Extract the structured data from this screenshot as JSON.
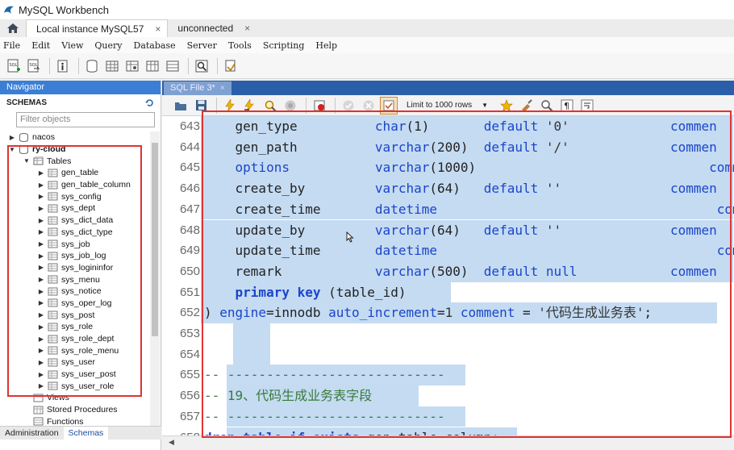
{
  "window": {
    "title": "MySQL Workbench"
  },
  "tabs": [
    {
      "label": "Local instance MySQL57",
      "close": "×",
      "active": true
    },
    {
      "label": "unconnected",
      "close": "×",
      "active": false
    }
  ],
  "menu": [
    "File",
    "Edit",
    "View",
    "Query",
    "Database",
    "Server",
    "Tools",
    "Scripting",
    "Help"
  ],
  "navigator": {
    "header": "Navigator",
    "schemas_label": "SCHEMAS",
    "filter_placeholder": "Filter objects",
    "tree": [
      {
        "label": "nacos",
        "indent": 0,
        "arrow": "▶",
        "icon": "database-icon",
        "bold": false
      },
      {
        "label": "ry-cloud",
        "indent": 0,
        "arrow": "▼",
        "icon": "database-icon",
        "bold": true
      },
      {
        "label": "Tables",
        "indent": 1,
        "arrow": "▼",
        "icon": "tables-folder-icon",
        "bold": false
      },
      {
        "label": "gen_table",
        "indent": 2,
        "arrow": "▶",
        "icon": "table-icon",
        "bold": false
      },
      {
        "label": "gen_table_column",
        "indent": 2,
        "arrow": "▶",
        "icon": "table-icon",
        "bold": false
      },
      {
        "label": "sys_config",
        "indent": 2,
        "arrow": "▶",
        "icon": "table-icon",
        "bold": false
      },
      {
        "label": "sys_dept",
        "indent": 2,
        "arrow": "▶",
        "icon": "table-icon",
        "bold": false
      },
      {
        "label": "sys_dict_data",
        "indent": 2,
        "arrow": "▶",
        "icon": "table-icon",
        "bold": false
      },
      {
        "label": "sys_dict_type",
        "indent": 2,
        "arrow": "▶",
        "icon": "table-icon",
        "bold": false
      },
      {
        "label": "sys_job",
        "indent": 2,
        "arrow": "▶",
        "icon": "table-icon",
        "bold": false
      },
      {
        "label": "sys_job_log",
        "indent": 2,
        "arrow": "▶",
        "icon": "table-icon",
        "bold": false
      },
      {
        "label": "sys_logininfor",
        "indent": 2,
        "arrow": "▶",
        "icon": "table-icon",
        "bold": false
      },
      {
        "label": "sys_menu",
        "indent": 2,
        "arrow": "▶",
        "icon": "table-icon",
        "bold": false
      },
      {
        "label": "sys_notice",
        "indent": 2,
        "arrow": "▶",
        "icon": "table-icon",
        "bold": false
      },
      {
        "label": "sys_oper_log",
        "indent": 2,
        "arrow": "▶",
        "icon": "table-icon",
        "bold": false
      },
      {
        "label": "sys_post",
        "indent": 2,
        "arrow": "▶",
        "icon": "table-icon",
        "bold": false
      },
      {
        "label": "sys_role",
        "indent": 2,
        "arrow": "▶",
        "icon": "table-icon",
        "bold": false
      },
      {
        "label": "sys_role_dept",
        "indent": 2,
        "arrow": "▶",
        "icon": "table-icon",
        "bold": false
      },
      {
        "label": "sys_role_menu",
        "indent": 2,
        "arrow": "▶",
        "icon": "table-icon",
        "bold": false
      },
      {
        "label": "sys_user",
        "indent": 2,
        "arrow": "▶",
        "icon": "table-icon",
        "bold": false
      },
      {
        "label": "sys_user_post",
        "indent": 2,
        "arrow": "▶",
        "icon": "table-icon",
        "bold": false
      },
      {
        "label": "sys_user_role",
        "indent": 2,
        "arrow": "▶",
        "icon": "table-icon",
        "bold": false
      },
      {
        "label": "Views",
        "indent": 1,
        "arrow": "",
        "icon": "views-folder-icon",
        "bold": false
      },
      {
        "label": "Stored Procedures",
        "indent": 1,
        "arrow": "",
        "icon": "procedures-folder-icon",
        "bold": false
      },
      {
        "label": "Functions",
        "indent": 1,
        "arrow": "",
        "icon": "functions-folder-icon",
        "bold": false
      }
    ],
    "bottom_tabs": [
      {
        "label": "Administration",
        "active": false
      },
      {
        "label": "Schemas",
        "active": true
      }
    ]
  },
  "editor": {
    "tab_label": "SQL File 3*",
    "tab_close": "×",
    "limit_label": "Limit to 1000 rows",
    "lines": [
      {
        "n": "643",
        "sel": [
          48,
          660
        ],
        "segs": [
          [
            "",
            "    "
          ],
          [
            "",
            "gen_type          "
          ],
          [
            "kt",
            "char"
          ],
          [
            "",
            "(1)       "
          ],
          [
            "kd",
            "default"
          ],
          [
            "",
            " "
          ],
          [
            "str",
            "'0'"
          ],
          [
            "",
            "             "
          ],
          [
            "kd",
            "commen"
          ]
        ]
      },
      {
        "n": "644",
        "sel": [
          48,
          660
        ],
        "segs": [
          [
            "",
            "    "
          ],
          [
            "",
            "gen_path          "
          ],
          [
            "kt",
            "varchar"
          ],
          [
            "",
            "(200)  "
          ],
          [
            "kd",
            "default"
          ],
          [
            "",
            " "
          ],
          [
            "str",
            "'/'"
          ],
          [
            "",
            "             "
          ],
          [
            "kd",
            "commen"
          ]
        ]
      },
      {
        "n": "645",
        "sel": [
          48,
          660
        ],
        "segs": [
          [
            "",
            "    "
          ],
          [
            "kd",
            "options"
          ],
          [
            "",
            "           "
          ],
          [
            "kt",
            "varchar"
          ],
          [
            "",
            "(1000)                              "
          ],
          [
            "kd",
            "commen"
          ]
        ]
      },
      {
        "n": "646",
        "sel": [
          48,
          660
        ],
        "segs": [
          [
            "",
            "    "
          ],
          [
            "",
            "create_by         "
          ],
          [
            "kt",
            "varchar"
          ],
          [
            "",
            "(64)   "
          ],
          [
            "kd",
            "default"
          ],
          [
            "",
            " "
          ],
          [
            "str",
            "''"
          ],
          [
            "",
            "              "
          ],
          [
            "kd",
            "commen"
          ]
        ]
      },
      {
        "n": "647",
        "sel": [
          48,
          660
        ],
        "segs": [
          [
            "",
            "    "
          ],
          [
            "",
            "create_time       "
          ],
          [
            "kt",
            "datetime"
          ],
          [
            "",
            "                                    "
          ],
          [
            "kd",
            "commen"
          ]
        ]
      },
      {
        "n": "648",
        "sel": [
          48,
          660
        ],
        "segs": [
          [
            "",
            "    "
          ],
          [
            "",
            "update_by         "
          ],
          [
            "kt",
            "varchar"
          ],
          [
            "",
            "(64)   "
          ],
          [
            "kd",
            "default"
          ],
          [
            "",
            " "
          ],
          [
            "str",
            "''"
          ],
          [
            "",
            "              "
          ],
          [
            "kd",
            "commen"
          ]
        ]
      },
      {
        "n": "649",
        "sel": [
          48,
          660
        ],
        "segs": [
          [
            "",
            "    "
          ],
          [
            "",
            "update_time       "
          ],
          [
            "kt",
            "datetime"
          ],
          [
            "",
            "                                    "
          ],
          [
            "kd",
            "commen"
          ]
        ]
      },
      {
        "n": "650",
        "sel": [
          48,
          660
        ],
        "segs": [
          [
            "",
            "    "
          ],
          [
            "",
            "remark            "
          ],
          [
            "kt",
            "varchar"
          ],
          [
            "",
            "(500)  "
          ],
          [
            "kd",
            "default"
          ],
          [
            "",
            " "
          ],
          [
            "kd",
            "null"
          ],
          [
            "",
            "            "
          ],
          [
            "kd",
            "commen"
          ]
        ]
      },
      {
        "n": "651",
        "sel": [
          48,
          310
        ],
        "segs": [
          [
            "",
            "    "
          ],
          [
            "kw",
            "primary key"
          ],
          [
            "",
            " (table_id)"
          ]
        ]
      },
      {
        "n": "652",
        "sel": [
          48,
          640
        ],
        "segs": [
          [
            "",
            ") "
          ],
          [
            "kd",
            "engine"
          ],
          [
            "",
            "=innodb "
          ],
          [
            "kd",
            "auto_increment"
          ],
          [
            "",
            "="
          ],
          [
            "num",
            "1"
          ],
          [
            "",
            " "
          ],
          [
            "kd",
            "comment"
          ],
          [
            "",
            " = "
          ],
          [
            "strcn",
            "'代码生成业务表'"
          ],
          [
            "",
            ";"
          ]
        ]
      },
      {
        "n": "653",
        "sel": [
          88,
          46
        ],
        "segs": []
      },
      {
        "n": "654",
        "sel": [
          88,
          46
        ],
        "segs": []
      },
      {
        "n": "655",
        "sel": [
          80,
          296
        ],
        "segs": [
          [
            "cmt",
            "-- ----------------------------"
          ]
        ]
      },
      {
        "n": "656",
        "sel": [
          80,
          238
        ],
        "segs": [
          [
            "cmt",
            "-- 19、代码生成业务表字段"
          ]
        ]
      },
      {
        "n": "657",
        "sel": [
          80,
          296
        ],
        "segs": [
          [
            "cmt",
            "-- ----------------------------"
          ]
        ]
      },
      {
        "n": "658",
        "sel": [
          80,
          360
        ],
        "segs": [
          [
            "kw",
            "drop table if exists"
          ],
          [
            "",
            " gen_table_column;"
          ]
        ]
      }
    ]
  },
  "colors": {
    "accent": "#3a7ed6",
    "selection": "#c4dbf2",
    "keyword": "#1b45c9",
    "comment": "#3a7a3a",
    "annotation": "#e03333"
  }
}
